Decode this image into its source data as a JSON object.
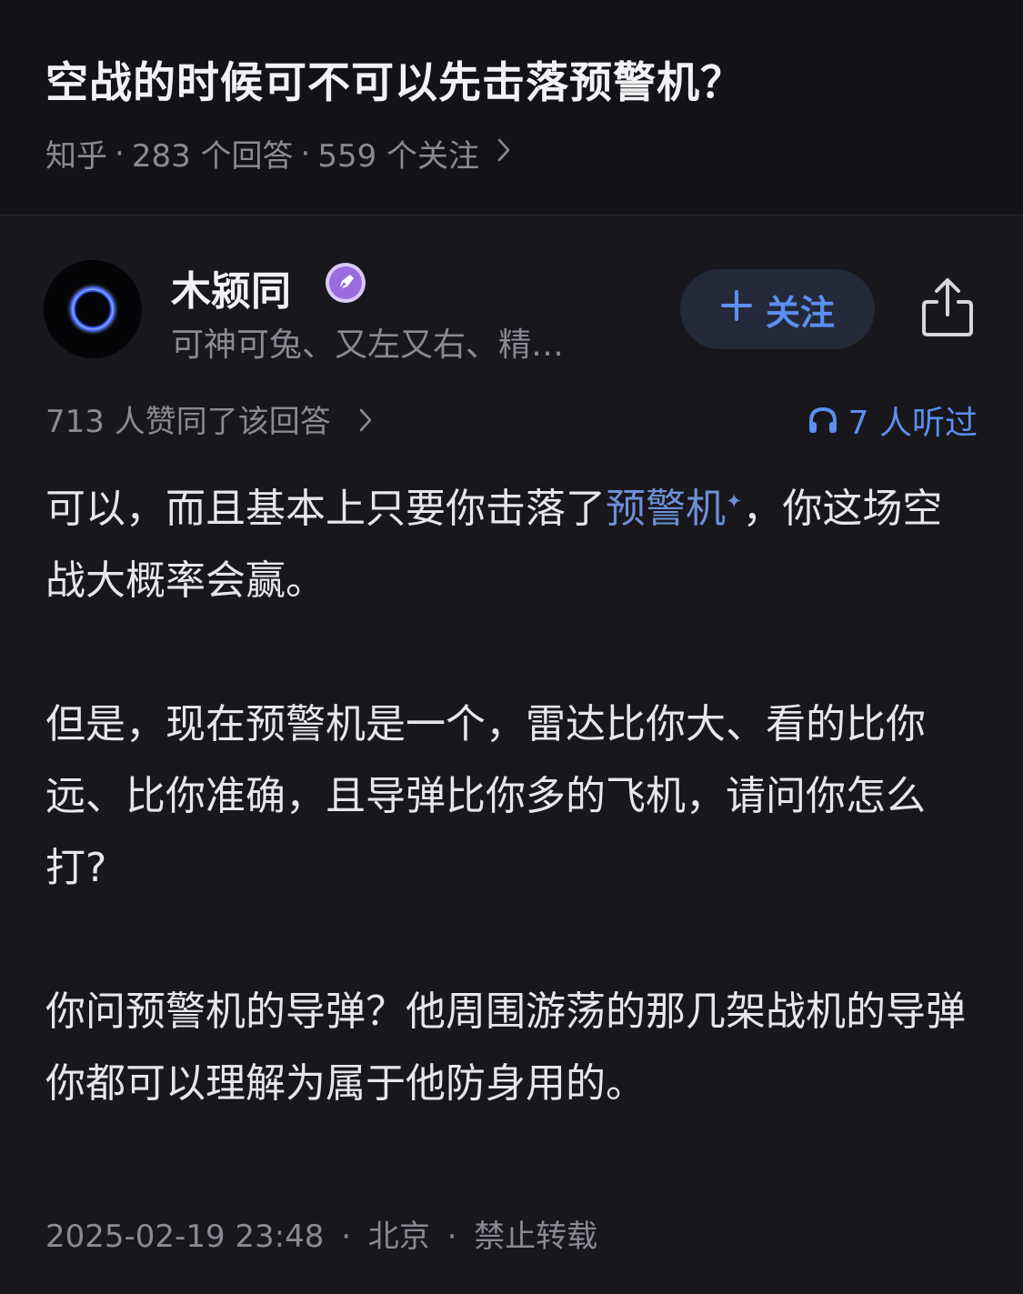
{
  "question": {
    "title": "空战的时候可不可以先击落预警机？",
    "source": "知乎",
    "answer_count": "283 个回答",
    "follower_count": "559 个关注",
    "separator": "·"
  },
  "author": {
    "name": "木颍同",
    "bio": "可神可兔、又左又右、精…",
    "follow_label": "关注",
    "badge_icon": "pen-badge-icon"
  },
  "stats": {
    "upvotes": "713 人赞同了该回答",
    "listened": "7 人听过"
  },
  "answer": {
    "p1_before": "可以，而且基本上只要你击落了",
    "p1_link": "预警机",
    "p1_after": "，你这场空战大概率会赢。",
    "p2": "但是，现在预警机是一个，雷达比你大、看的比你远、比你准确，且导弹比你多的飞机，请问你怎么打?",
    "p3": "你问预警机的导弹？他周围游荡的那几架战机的导弹你都可以理解为属于他防身用的。"
  },
  "footer": {
    "datetime": "2025-02-19 23:48",
    "location": "北京",
    "copyright": "禁止转载",
    "separator": "·"
  },
  "colors": {
    "background": "#17171c",
    "accent": "#5b8ff0",
    "keyword_link": "#6e8fd8",
    "muted_text": "#8a8a93",
    "badge": "#9b6be0"
  }
}
